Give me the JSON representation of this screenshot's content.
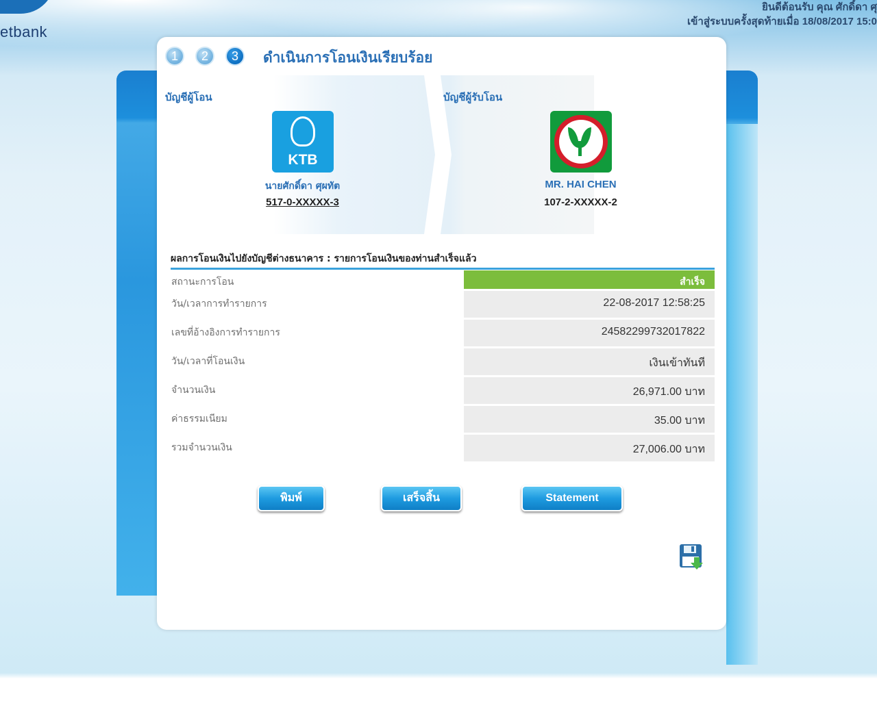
{
  "brand": {
    "logo_text": "etbank"
  },
  "header": {
    "welcome": "ยินดีต้อนรับ คุณ ศักดิ์ดา ศุ",
    "last_login": "เข้าสู่ระบบครั้งสุดท้ายเมื่อ 18/08/2017 15:0"
  },
  "steps": [
    "1",
    "2",
    "3"
  ],
  "page_title": "ดำเนินการโอนเงินเรียบร้อย",
  "from_account": {
    "label": "บัญชีผู้โอน",
    "bank_logo_text": "KTB",
    "name": "นายศักดิ์ดา ศุผทัต",
    "number": "517-0-XXXXX-3"
  },
  "to_account": {
    "label": "บัญชีผู้รับโอน",
    "name": "MR. HAI CHEN",
    "number": "107-2-XXXXX-2"
  },
  "result": {
    "heading": "ผลการโอนเงินไปยังบัญชีต่างธนาคาร : รายการโอนเงินของท่านสำเร็จแล้ว",
    "rows": [
      {
        "label": "สถานะการโอน",
        "value": "สำเร็จ"
      },
      {
        "label": "วัน/เวลาการทำรายการ",
        "value": "22-08-2017 12:58:25"
      },
      {
        "label": "เลขที่อ้างอิงการทำรายการ",
        "value": "24582299732017822"
      },
      {
        "label": "วัน/เวลาที่โอนเงิน",
        "value": "เงินเข้าทันที"
      },
      {
        "label": "จำนวนเงิน",
        "value": "26,971.00 บาท"
      },
      {
        "label": "ค่าธรรมเนียม",
        "value": "35.00 บาท"
      },
      {
        "label": "รวมจำนวนเงิน",
        "value": "27,006.00 บาท"
      }
    ]
  },
  "buttons": {
    "print": "พิมพ์",
    "done": "เสร็จสิ้น",
    "statement": "Statement"
  },
  "colors": {
    "accent": "#2a6fb5",
    "success": "#7cbd3c",
    "button": "#1e9be0"
  },
  "icons": {
    "save": "floppy-disk-save-icon"
  }
}
